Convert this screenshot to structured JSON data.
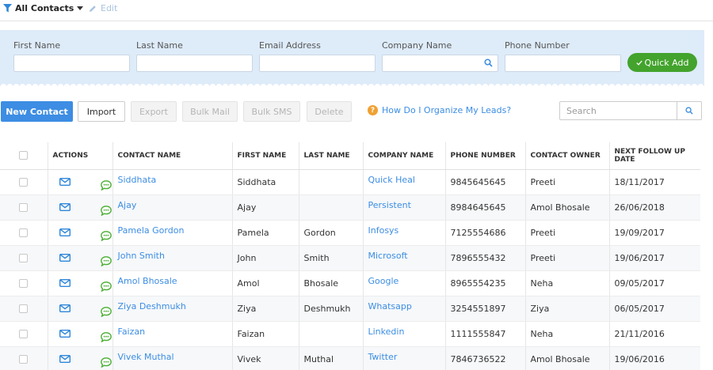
{
  "viewbar": {
    "view_label": "All Contacts",
    "edit_label": "Edit"
  },
  "quick_add": {
    "fields": [
      {
        "label": "First Name",
        "value": ""
      },
      {
        "label": "Last Name",
        "value": ""
      },
      {
        "label": "Email Address",
        "value": ""
      },
      {
        "label": "Company Name",
        "value": ""
      },
      {
        "label": "Phone Number",
        "value": ""
      }
    ],
    "button_label": "Quick Add"
  },
  "toolbar": {
    "new_contact": "New Contact",
    "import": "Import",
    "export": "Export",
    "bulk_mail": "Bulk Mail",
    "bulk_sms": "Bulk SMS",
    "delete": "Delete",
    "help_link": "How Do I Organize My Leads?",
    "search_placeholder": "Search"
  },
  "table": {
    "headers": {
      "actions": "Actions",
      "contact_name": "Contact Name",
      "first_name": "First Name",
      "last_name": "Last Name",
      "company_name": "Company Name",
      "phone_number": "Phone Number",
      "contact_owner": "Contact Owner",
      "next_follow_up": "Next Follow Up Date"
    },
    "rows": [
      {
        "contact_name": "Siddhata",
        "first_name": "Siddhata",
        "last_name": "",
        "company": "Quick Heal",
        "phone": "9845645645",
        "owner": "Preeti",
        "follow_up": "18/11/2017"
      },
      {
        "contact_name": "Ajay",
        "first_name": "Ajay",
        "last_name": "",
        "company": "Persistent",
        "phone": "8984645645",
        "owner": "Amol Bhosale",
        "follow_up": "26/06/2018"
      },
      {
        "contact_name": "Pamela Gordon",
        "first_name": "Pamela",
        "last_name": "Gordon",
        "company": "Infosys",
        "phone": "7125554686",
        "owner": "Preeti",
        "follow_up": "19/09/2017"
      },
      {
        "contact_name": "John Smith",
        "first_name": "John",
        "last_name": "Smith",
        "company": "Microsoft",
        "phone": "7896555432",
        "owner": "Preeti",
        "follow_up": "19/06/2017"
      },
      {
        "contact_name": "Amol Bhosale",
        "first_name": "Amol",
        "last_name": "Bhosale",
        "company": "Google",
        "phone": "8965554235",
        "owner": "Neha",
        "follow_up": "09/05/2017"
      },
      {
        "contact_name": "Ziya Deshmukh",
        "first_name": "Ziya",
        "last_name": "Deshmukh",
        "company": "Whatsapp",
        "phone": "3254551897",
        "owner": "Ziya",
        "follow_up": "06/05/2017"
      },
      {
        "contact_name": "Faizan",
        "first_name": "Faizan",
        "last_name": "",
        "company": "Linkedin",
        "phone": "1111555847",
        "owner": "Neha",
        "follow_up": "21/11/2016"
      },
      {
        "contact_name": "Vivek Muthal",
        "first_name": "Vivek",
        "last_name": "Muthal",
        "company": "Twitter",
        "phone": "7846736522",
        "owner": "Amol Bhosale",
        "follow_up": "19/06/2016"
      }
    ]
  },
  "colors": {
    "accent": "#3c8de3",
    "quick_add_green": "#43a32d",
    "panel_bg": "#deebf9",
    "help_orange": "#f0a132"
  },
  "icons": [
    "filter-icon",
    "caret-down-icon",
    "pencil-icon",
    "search-icon",
    "check-icon",
    "question-icon",
    "mail-icon",
    "sms-icon"
  ]
}
